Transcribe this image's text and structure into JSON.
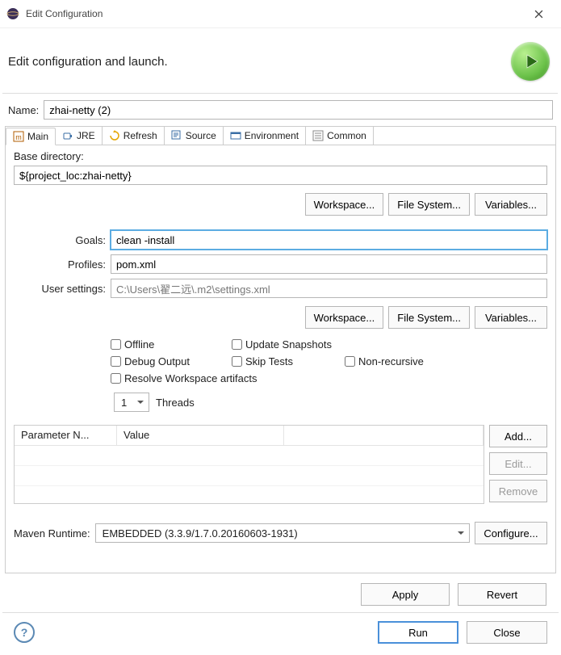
{
  "window": {
    "title": "Edit Configuration"
  },
  "header": {
    "text": "Edit configuration and launch."
  },
  "name": {
    "label": "Name:",
    "value": "zhai-netty (2)"
  },
  "tabs": [
    {
      "label": "Main"
    },
    {
      "label": "JRE"
    },
    {
      "label": "Refresh"
    },
    {
      "label": "Source"
    },
    {
      "label": "Environment"
    },
    {
      "label": "Common"
    }
  ],
  "base_dir": {
    "label": "Base directory:",
    "value": "${project_loc:zhai-netty}",
    "workspace_btn": "Workspace...",
    "filesystem_btn": "File System...",
    "variables_btn": "Variables..."
  },
  "goals": {
    "label": "Goals:",
    "value": "clean -install"
  },
  "profiles": {
    "label": "Profiles:",
    "value": "pom.xml"
  },
  "user_settings": {
    "label": "User settings:",
    "value": "C:\\Users\\翟二远\\.m2\\settings.xml",
    "workspace_btn": "Workspace...",
    "filesystem_btn": "File System...",
    "variables_btn": "Variables..."
  },
  "checks": {
    "offline": "Offline",
    "update_snapshots": "Update Snapshots",
    "debug": "Debug Output",
    "skip_tests": "Skip Tests",
    "non_recursive": "Non-recursive",
    "resolve_ws": "Resolve Workspace artifacts"
  },
  "threads": {
    "value": "1",
    "label": "Threads"
  },
  "params": {
    "col_name": "Parameter N...",
    "col_value": "Value",
    "add": "Add...",
    "edit": "Edit...",
    "remove": "Remove"
  },
  "runtime": {
    "label": "Maven Runtime:",
    "value": "EMBEDDED (3.3.9/1.7.0.20160603-1931)",
    "configure": "Configure..."
  },
  "apply": "Apply",
  "revert": "Revert",
  "run": "Run",
  "close": "Close"
}
